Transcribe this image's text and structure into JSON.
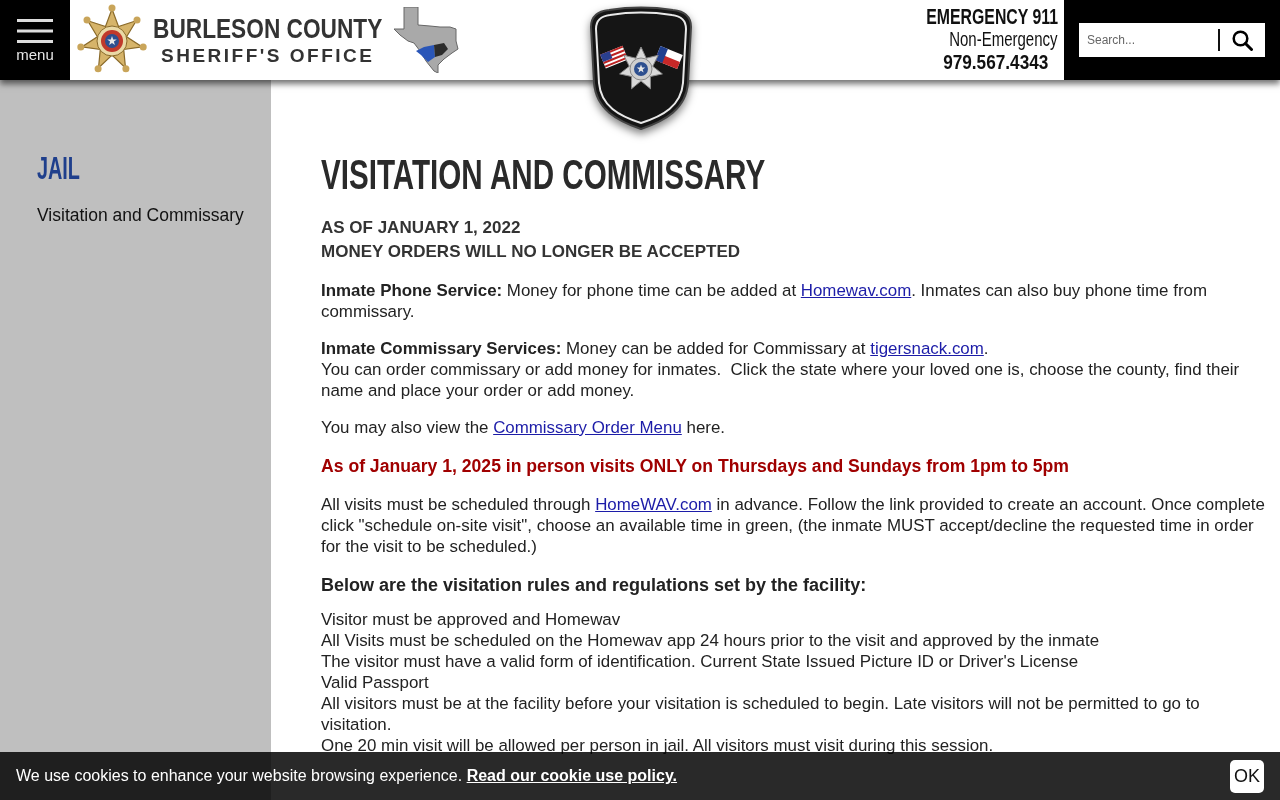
{
  "header": {
    "menu_label": "menu",
    "title": [
      "BURLESON COUNTY",
      "SHERIFF'S OFFICE"
    ],
    "emergency": "EMERGENCY 911",
    "non_emergency": "Non-Emergency",
    "phone": "979.567.4343",
    "search": {
      "placeholder": "Search..."
    }
  },
  "sidebar": {
    "heading": "JAIL",
    "items": [
      {
        "label": "Visitation and Commissary"
      }
    ]
  },
  "main": {
    "title": "VISITATION AND COMMISSARY",
    "blocks": [
      {
        "kind": "notice",
        "lines": [
          "AS OF JANUARY 1, 2022",
          "MONEY ORDERS WILL NO LONGER BE ACCEPTED"
        ]
      },
      {
        "kind": "paragraph",
        "segments": [
          {
            "kind": "text",
            "text": "**Inmate Phone Service:** Money for phone time can be added at "
          },
          {
            "kind": "link",
            "text": "Homewav.com"
          },
          {
            "kind": "text",
            "text": ". Inmates can also buy phone time from commissary."
          }
        ]
      },
      {
        "kind": "paragraph",
        "segments": [
          {
            "kind": "text",
            "text": "**Inmate Commissary Services:** Money can be added for Commissary at "
          },
          {
            "kind": "link",
            "text": "tigersnack.com"
          },
          {
            "kind": "text",
            "text": "."
          },
          {
            "kind": "break"
          },
          {
            "kind": "text",
            "text": "You can order commissary or add money for inmates.  Click the state where your loved one is, choose the county, find their name and place your order or add money."
          }
        ]
      },
      {
        "kind": "paragraph",
        "segments": [
          {
            "kind": "text",
            "text": "You may also view the "
          },
          {
            "kind": "link",
            "text": "Commissary Order Menu"
          },
          {
            "kind": "text",
            "text": " here."
          }
        ]
      },
      {
        "kind": "alert",
        "text": "As of January 1, 2025 in person visits ONLY on Thursdays and Sundays from 1pm to 5pm"
      },
      {
        "kind": "paragraph",
        "segments": [
          {
            "kind": "text",
            "text": "All visits must be scheduled through "
          },
          {
            "kind": "link",
            "text": "HomeWAV.com"
          },
          {
            "kind": "text",
            "text": " in advance. Follow the link provided to create an account. Once complete click \"schedule on-site visit\", choose an available time in green, (the inmate MUST accept/decline the requested time in order for the visit to be scheduled.)"
          }
        ]
      },
      {
        "kind": "subheading",
        "text": "Below are the visitation rules and regulations set by the facility:"
      },
      {
        "kind": "rules",
        "lines": [
          "Visitor must be approved and Homewav",
          "All Visits must be scheduled on the Homewav app 24 hours prior to the visit and approved by the inmate",
          "The visitor must have a valid form of identification. Current State Issued Picture ID or Driver's License",
          "Valid Passport",
          "All visitors must be at the facility before your visitation is scheduled to begin. Late visitors will not be permitted to go to visitation.",
          "One 20 min visit will be allowed per person in jail. All visitors must visit during this session."
        ]
      }
    ]
  },
  "cookie_bar": {
    "text": "We use cookies to enhance your website browsing experience.",
    "link": "Read our cookie use policy.",
    "button": "OK"
  }
}
